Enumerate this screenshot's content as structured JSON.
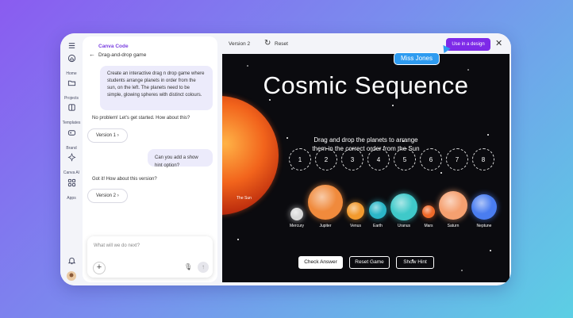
{
  "rail": {
    "items": [
      {
        "label": "",
        "icon": "menu-icon"
      },
      {
        "label": "Home",
        "icon": "home-icon"
      },
      {
        "label": "Projects",
        "icon": "folder-icon"
      },
      {
        "label": "Templates",
        "icon": "templates-icon"
      },
      {
        "label": "Brand",
        "icon": "brand-icon"
      },
      {
        "label": "Canva AI",
        "icon": "canva-ai-icon"
      },
      {
        "label": "Apps",
        "icon": "apps-icon"
      }
    ]
  },
  "chat": {
    "brand": "Canva Code",
    "breadcrumb": "Drag-and-drop game",
    "prompt1": "Create an interactive drag n drop game where students arrange planets in order from the sun, on the left. The planets need to be simple, glowing spheres with distinct colours.",
    "reply1": "No problem! Let's get started. How about this?",
    "version1": "Version 1",
    "prompt2": "Can you add a show hint option?",
    "reply2": "Got it! How about this version?",
    "version2": "Version 2",
    "input_placeholder": "What will we do next?"
  },
  "topbar": {
    "version": "Version 2",
    "reset": "Reset",
    "use_in_design": "Use in a design",
    "collaborator": "Miss Jones"
  },
  "game": {
    "title": "Cosmic Sequence",
    "subtitle_line1": "Drag and drop the planets to arrange",
    "subtitle_line2": "them in the correct order from the Sun",
    "slots": [
      "1",
      "2",
      "3",
      "4",
      "5",
      "6",
      "7",
      "8"
    ],
    "sun_label": "The Sun",
    "planets": [
      {
        "name": "Mercury",
        "color": "#d8d8d8"
      },
      {
        "name": "Jupiter",
        "color": "#f08a3c"
      },
      {
        "name": "Venus",
        "color": "#f29a2e"
      },
      {
        "name": "Earth",
        "color": "#2bb6c8"
      },
      {
        "name": "Uranus",
        "color": "#3fc9c9"
      },
      {
        "name": "Mars",
        "color": "#f06a2a"
      },
      {
        "name": "Saturn",
        "color": "#f5a070"
      },
      {
        "name": "Neptune",
        "color": "#4a7df0"
      }
    ],
    "buttons": {
      "check": "Check Answer",
      "reset": "Reset Game",
      "hint": "Show Hint"
    }
  },
  "colors": {
    "accent": "#7d2ae8",
    "badge": "#2e9bf0",
    "game_bg": "#0b0b0f",
    "bubble": "#ecebfb"
  }
}
